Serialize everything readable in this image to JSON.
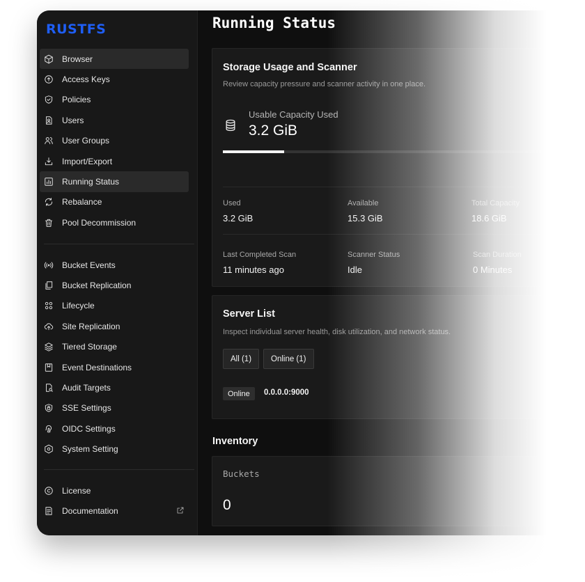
{
  "brand": {
    "logo_text": "RUSTFS",
    "accent": "#1f5ef5"
  },
  "sidebar": {
    "items": [
      {
        "label": "Browser",
        "icon": "cube-icon",
        "active": true
      },
      {
        "label": "Access Keys",
        "icon": "key-circle-icon"
      },
      {
        "label": "Policies",
        "icon": "shield-check-icon"
      },
      {
        "label": "Users",
        "icon": "user-file-icon"
      },
      {
        "label": "User Groups",
        "icon": "users-icon"
      },
      {
        "label": "Import/Export",
        "icon": "download-tray-icon"
      },
      {
        "label": "Running Status",
        "icon": "bar-chart-icon",
        "active": true
      },
      {
        "label": "Rebalance",
        "icon": "refresh-icon"
      },
      {
        "label": "Pool Decommission",
        "icon": "trash-icon"
      }
    ],
    "items2": [
      {
        "label": "Bucket Events",
        "icon": "broadcast-icon"
      },
      {
        "label": "Bucket Replication",
        "icon": "copy-icon"
      },
      {
        "label": "Lifecycle",
        "icon": "lifecycle-icon"
      },
      {
        "label": "Site Replication",
        "icon": "cloud-upload-icon"
      },
      {
        "label": "Tiered Storage",
        "icon": "layers-icon"
      },
      {
        "label": "Event Destinations",
        "icon": "bookmark-icon"
      },
      {
        "label": "Audit Targets",
        "icon": "file-search-icon"
      },
      {
        "label": "SSE Settings",
        "icon": "shield-lock-icon"
      },
      {
        "label": "OIDC Settings",
        "icon": "fingerprint-icon"
      },
      {
        "label": "System Setting",
        "icon": "hexagon-gear-icon"
      }
    ],
    "items3": [
      {
        "label": "License",
        "icon": "copyright-icon"
      },
      {
        "label": "Documentation",
        "icon": "document-icon",
        "external": true
      }
    ]
  },
  "main": {
    "title": "Running Status",
    "storage": {
      "title": "Storage Usage and Scanner",
      "subtitle": "Review capacity pressure and scanner activity in one place.",
      "capacity_label": "Usable Capacity Used",
      "capacity_value": "3.2 GiB",
      "usage_fraction": 0.172,
      "stats": [
        {
          "label": "Used",
          "value": "3.2 GiB"
        },
        {
          "label": "Available",
          "value": "15.3 GiB"
        },
        {
          "label": "Total Capacity",
          "value": "18.6 GiB"
        }
      ],
      "scanner": [
        {
          "label": "Last Completed Scan",
          "value": "11 minutes ago"
        },
        {
          "label": "Scanner Status",
          "value": "Idle"
        },
        {
          "label": "Scan Duration",
          "value": "0 Minutes"
        }
      ]
    },
    "servers": {
      "title": "Server List",
      "subtitle": "Inspect individual server health, disk utilization, and network status.",
      "filter_all": "All (1)",
      "filter_online": "Online (1)",
      "rows": [
        {
          "status": "Online",
          "address": "0.0.0.0:9000"
        }
      ]
    },
    "inventory": {
      "title": "Inventory",
      "buckets_label": "Buckets",
      "buckets_value": "0"
    }
  }
}
